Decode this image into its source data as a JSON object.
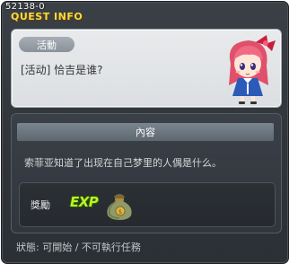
{
  "window": {
    "quest_id": "52138-0",
    "title": "QUEST INFO"
  },
  "header": {
    "category": "活動",
    "quest_name": "[活动] 恰吉是谁?",
    "npc": "pink-hair-girl-npc"
  },
  "body": {
    "section_label": "內容",
    "description": "索菲亚知道了出现在自己梦里的人偶是什么。",
    "reward": {
      "label": "獎勵",
      "exp_label": "EXP",
      "item_icon": "money-bag-icon"
    }
  },
  "footer": {
    "status": "狀態: 可開始 / 不可執行任務"
  },
  "colors": {
    "title": "#ffd940",
    "exp": "#b8f22c",
    "panel_light": "#e0e3e6",
    "panel_dark": "#30363c"
  }
}
